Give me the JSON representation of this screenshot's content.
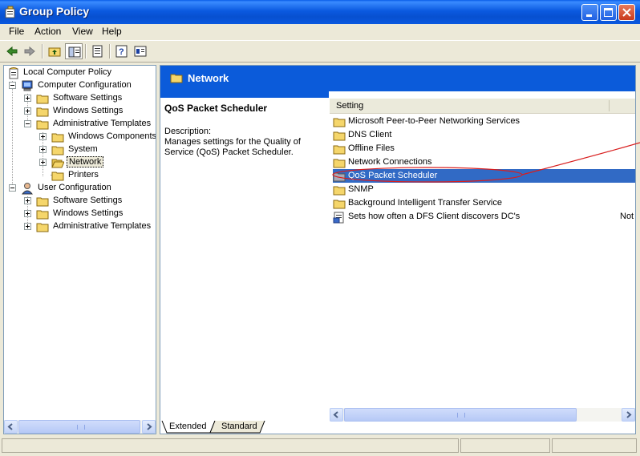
{
  "window": {
    "title": "Group Policy"
  },
  "menu": [
    "File",
    "Action",
    "View",
    "Help"
  ],
  "toolbar": {
    "buttons": [
      "back-icon",
      "forward-icon",
      "up-folder-icon",
      "show-hide-tree-icon",
      "export-list-icon",
      "help-icon",
      "properties-icon"
    ]
  },
  "tree": {
    "root": "Local Computer Policy",
    "computer_configuration": "Computer Configuration",
    "cc_software_settings": "Software Settings",
    "cc_windows_settings": "Windows Settings",
    "cc_administrative_templates": "Administrative Templates",
    "windows_components": "Windows Components",
    "system": "System",
    "network": "Network",
    "printers": "Printers",
    "user_configuration": "User Configuration",
    "uc_software_settings": "Software Settings",
    "uc_windows_settings": "Windows Settings",
    "uc_administrative_templates": "Administrative Templates"
  },
  "right": {
    "header": "Network",
    "description": {
      "title": "QoS Packet Scheduler",
      "label": "Description:",
      "text": "Manages settings for the Quality of Service (QoS) Packet Scheduler."
    },
    "column_header": "Setting",
    "items": [
      {
        "label": "Microsoft Peer-to-Peer Networking Services",
        "icon": "folder-icon"
      },
      {
        "label": "DNS Client",
        "icon": "folder-icon"
      },
      {
        "label": "Offline Files",
        "icon": "folder-icon"
      },
      {
        "label": "Network Connections",
        "icon": "folder-icon"
      },
      {
        "label": "QoS Packet Scheduler",
        "icon": "folder-icon",
        "selected": true
      },
      {
        "label": "SNMP",
        "icon": "folder-icon"
      },
      {
        "label": "Background Intelligent Transfer Service",
        "icon": "folder-icon"
      },
      {
        "label": "Sets how often a DFS Client discovers DC's",
        "icon": "policy-setting-icon",
        "state": "Not"
      }
    ],
    "view_tabs": [
      "Extended",
      "Standard"
    ]
  },
  "colors": {
    "title_bar": "#0b5ae0",
    "header": "#0b5bda",
    "selection": "#316ac5",
    "annotation": "#d81e1e"
  }
}
